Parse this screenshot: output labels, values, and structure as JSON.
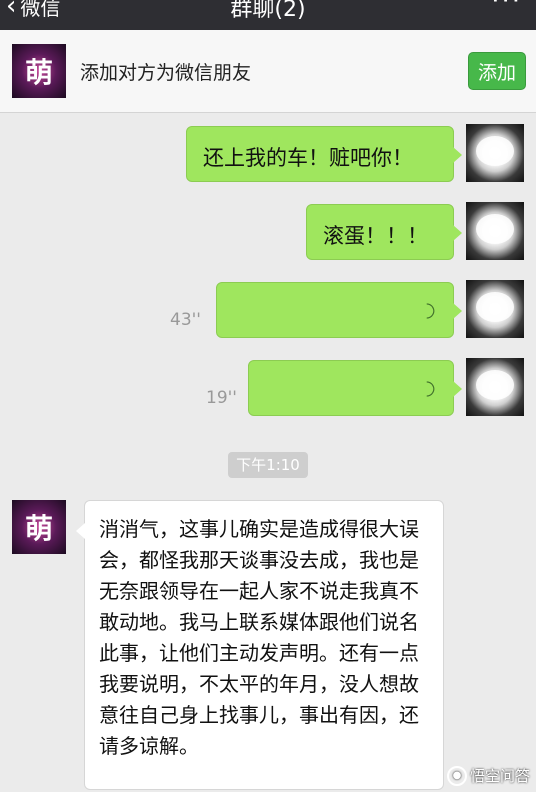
{
  "nav": {
    "back_label": "微信",
    "title": "群聊(2)",
    "more_label": "···"
  },
  "add_bar": {
    "avatar_text": "萌",
    "prompt": "添加对方为微信朋友",
    "button_label": "添加"
  },
  "messages": [
    {
      "text": "还上我的车！赃吧你！"
    },
    {
      "text": "滚蛋！！！"
    },
    {
      "voice_duration": "43''"
    },
    {
      "voice_duration": "19''"
    }
  ],
  "timestamp": "下午1:10",
  "reply": {
    "avatar_text": "萌",
    "text": "消消气，这事儿确实是造成得很大误会，都怪我那天谈事没去成，我也是无奈跟领导在一起人家不说走我真不敢动地。我马上联系媒体跟他们说名此事，让他们主动发声明。还有一点我要说明，不太平的年月，没人想故意往自己身上找事儿，事出有因，还请多谅解。"
  },
  "watermark": "悟空问答",
  "colors": {
    "bubble_green": "#9fe65e",
    "add_button": "#47b84a",
    "nav_bg": "#2e2e33"
  },
  "icons": [
    "chevron-left-icon",
    "more-icon",
    "voice-wave-icon",
    "watermark-logo-icon"
  ]
}
